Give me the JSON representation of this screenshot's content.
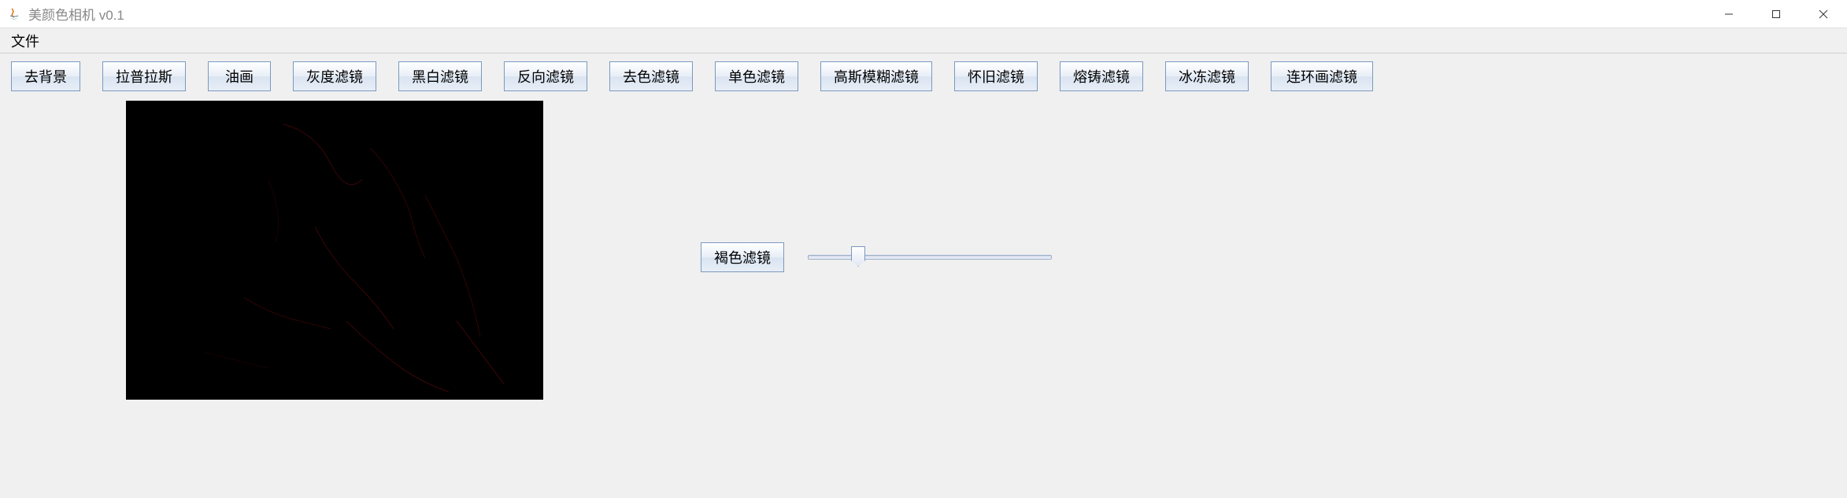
{
  "window": {
    "title": "美颜色相机 v0.1"
  },
  "menu": {
    "file": "文件"
  },
  "toolbar": {
    "buttons": [
      "去背景",
      "拉普拉斯",
      "油画",
      "灰度滤镜",
      "黑白滤镜",
      "反向滤镜",
      "去色滤镜",
      "单色滤镜",
      "高斯模糊滤镜",
      "怀旧滤镜",
      "熔铸滤镜",
      "冰冻滤镜",
      "连环画滤镜"
    ],
    "sepia_button": "褐色滤镜"
  },
  "slider": {
    "value": 18,
    "min": 0,
    "max": 100
  }
}
